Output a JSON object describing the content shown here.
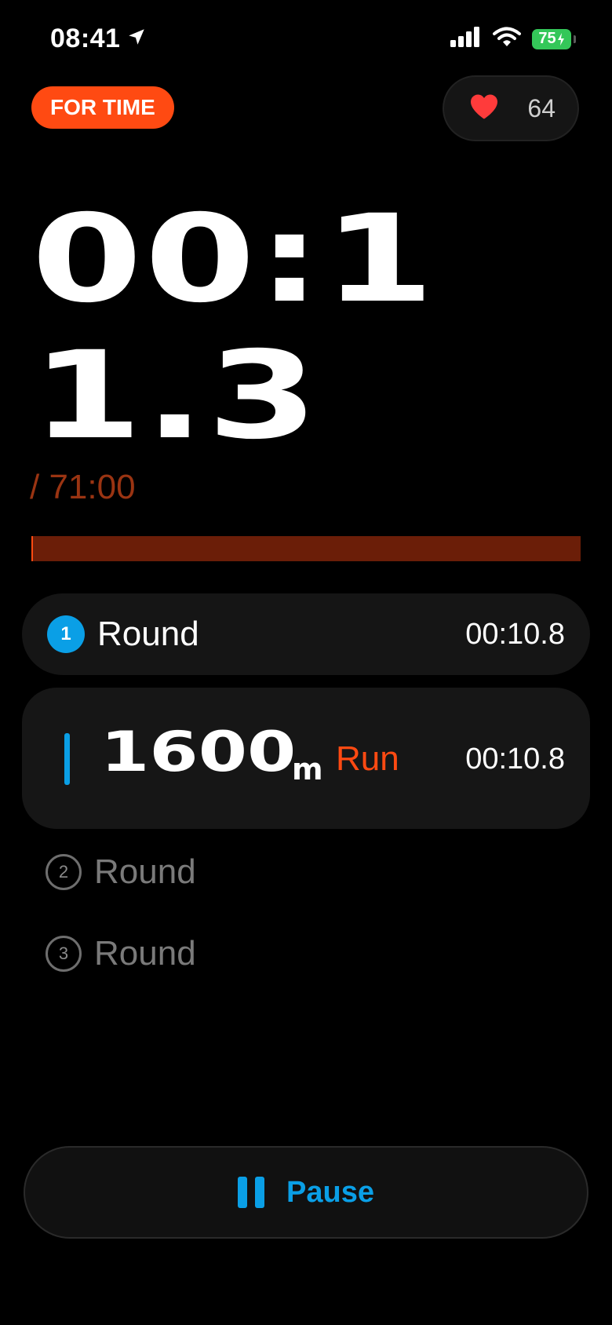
{
  "status_bar": {
    "time": "08:41",
    "battery_level": "75",
    "icons": [
      "location-arrow-icon",
      "cellular-signal-icon",
      "wifi-icon",
      "battery-charging-icon"
    ]
  },
  "workout": {
    "mode": "FOR TIME",
    "heart_rate": "64",
    "elapsed": "00:11.3",
    "time_limit": "/ 71:00",
    "progress_fraction": 0.0027
  },
  "rounds": [
    {
      "number": "1",
      "label": "Round",
      "time": "00:10.8",
      "state": "active",
      "exercise": {
        "quantity": "1600",
        "unit": "m",
        "name": "Run",
        "time": "00:10.8"
      }
    },
    {
      "number": "2",
      "label": "Round",
      "state": "pending"
    },
    {
      "number": "3",
      "label": "Round",
      "state": "pending"
    }
  ],
  "controls": {
    "pause_label": "Pause"
  },
  "colors": {
    "accent_orange": "#ff4a12",
    "accent_blue": "#0a9fe6",
    "heart_red": "#ff3b3b",
    "battery_green": "#34c759",
    "progress_track": "#6b1e08"
  }
}
